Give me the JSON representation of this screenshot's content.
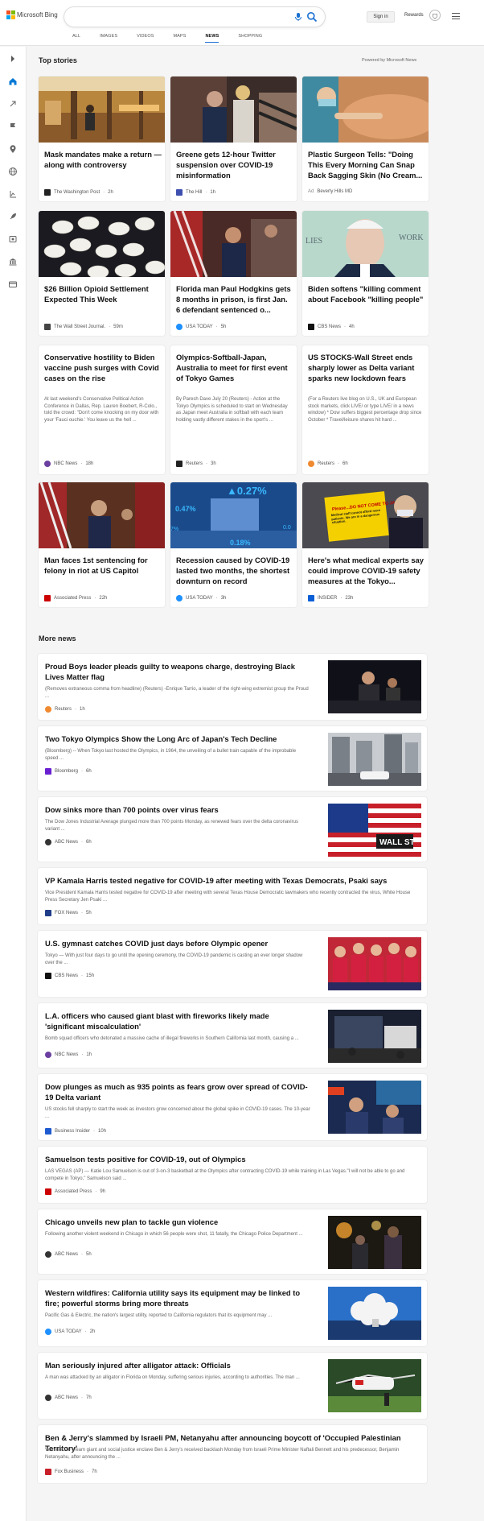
{
  "header": {
    "brand": "Microsoft Bing",
    "signin": "Sign in",
    "rewards": "Rewards",
    "tabs": [
      "ALL",
      "IMAGES",
      "VIDEOS",
      "MAPS",
      "NEWS",
      "SHOPPING"
    ],
    "active_tab": "NEWS"
  },
  "top_stories": {
    "title": "Top stories",
    "powered_by": "Powered by Microsoft News",
    "cards": [
      {
        "title": "Mask mandates make a return — along with controversy",
        "source": "The Washington Post",
        "time": "2h"
      },
      {
        "title": "Greene gets 12-hour Twitter suspension over COVID-19 misinformation",
        "source": "The Hill",
        "time": "1h"
      },
      {
        "title": "Plastic Surgeon Tells: \"Doing This Every Morning Can Snap Back Sagging Skin (No Cream...",
        "source": "Beverly Hills MD",
        "ad": "Ad"
      },
      {
        "title": "$26 Billion Opioid Settlement Expected This Week",
        "source": "The Wall Street Journal.",
        "time": "59m"
      },
      {
        "title": "Florida man Paul Hodgkins gets 8 months in prison, is first Jan. 6 defendant sentenced o...",
        "source": "USA TODAY",
        "time": "5h"
      },
      {
        "title": "Biden softens \"killing comment about Facebook \"killing people\"",
        "source": "CBS News",
        "time": "4h"
      },
      {
        "title": "Conservative hostility to Biden vaccine push surges with Covid cases on the rise",
        "snippet": "At last weekend's Conservative Political Action Conference in Dallas, Rep. Lauren Boebert, R-Colo., told the crowd: \"Don't come knocking on my door with your 'Fauci ouchie.' You leave us the hell ...",
        "source": "NBC News",
        "time": "18h"
      },
      {
        "title": "Olympics-Softball-Japan, Australia to meet for first event of Tokyo Games",
        "snippet": "By Paresh Dave July 20 (Reuters) - Action at the Tokyo Olympics is scheduled to start on Wednesday as Japan meet Australia in softball with each team holding vastly different stakes in the sport's ...",
        "source": "Reuters",
        "time": "3h"
      },
      {
        "title": "US STOCKS-Wall Street ends sharply lower as Delta variant sparks new lockdown fears",
        "snippet": "(For a Reuters live blog on U.S., UK and European stock markets, click LIVE/ or type LIVE/ in a news window) * Dow suffers biggest percentage drop since October * Travel/leisure shares hit hard ...",
        "source": "Reuters",
        "time": "6h"
      },
      {
        "title": "Man faces 1st sentencing for felony in riot at US Capitol",
        "source": "Associated Press",
        "time": "22h"
      },
      {
        "title": "Recession caused by COVID-19 lasted two months, the shortest downturn on record",
        "source": "USA TODAY",
        "time": "3h"
      },
      {
        "title": "Here's what medical experts say could improve COVID-19 safety measures at the Tokyo...",
        "source": "INSIDER",
        "time": "23h"
      }
    ],
    "thumb_texts": {
      "stock_big": "▲0.27%",
      "stock_a": "0.47%",
      "stock_b": "7%",
      "stock_c": "0.18%",
      "stock_d": "0.0",
      "sign_top": "Please...DO NOT COME TO JAPAN",
      "sign_body": "Medical staff cannot afford more patients. We are in a dangerous situation.",
      "lies": "LIES",
      "work": "WORK",
      "wall_st": "WALL ST"
    }
  },
  "more_news": {
    "title": "More news",
    "items": [
      {
        "title": "Proud Boys leader pleads guilty to weapons charge, destroying Black Lives Matter flag",
        "snippet": "(Removes extraneous comma from headline) (Reuters) -Enrique Tarrio, a leader of the right-wing extremist group the Proud ...",
        "source": "Reuters",
        "time": "1h"
      },
      {
        "title": "Two Tokyo Olympics Show the Long Arc of Japan's Tech Decline",
        "snippet": "(Bloomberg) -- When Tokyo last hosted the Olympics, in 1964, the unveiling of a bullet train capable of the improbable speed ...",
        "source": "Bloomberg",
        "time": "6h"
      },
      {
        "title": "Dow sinks more than 700 points over virus fears",
        "snippet": "The Dow Jones Industrial Average plunged more than 700 points Monday, as renewed fears over the delta coronavirus variant ...",
        "source": "ABC News",
        "time": "6h"
      },
      {
        "title": "VP Kamala Harris tested negative for COVID-19 after meeting with Texas Democrats, Psaki says",
        "snippet": "Vice President Kamala Harris tested negative for COVID-19 after meeting with several Texas House Democratic lawmakers who recently contracted the virus, White House Press Secretary Jen Psaki ...",
        "source": "FOX News",
        "time": "5h"
      },
      {
        "title": "U.S. gymnast catches COVID just days before Olympic opener",
        "snippet": "Tokyo — With just four days to go until the opening ceremony, the COVID-19 pandemic is casting an ever longer shadow over the ...",
        "source": "CBS News",
        "time": "15h"
      },
      {
        "title": "L.A. officers who caused giant blast with fireworks likely made 'significant miscalculation'",
        "snippet": "Bomb squad officers who detonated a massive cache of illegal fireworks in Southern California last month, causing a ...",
        "source": "NBC News",
        "time": "1h"
      },
      {
        "title": "Dow plunges as much as 935 points as fears grow over spread of COVID-19 Delta variant",
        "snippet": "US stocks fell sharply to start the week as investors grow concerned about the global spike in COVID-19 cases. The 10-year ...",
        "source": "Business Insider",
        "time": "10h"
      },
      {
        "title": "Samuelson tests positive for COVID-19, out of Olympics",
        "snippet": "LAS VEGAS (AP) — Katie Lou Samuelson is out of 3-on-3 basketball at the Olympics after contracting COVID-19 while training in Las Vegas.\"I will not be able to go and compete in Tokyo,\" Samuelson said ...",
        "source": "Associated Press",
        "time": "9h"
      },
      {
        "title": "Chicago unveils new plan to tackle gun violence",
        "snippet": "Following another violent weekend in Chicago in which 56 people were shot, 11 fatally, the Chicago Police Department ...",
        "source": "ABC News",
        "time": "5h"
      },
      {
        "title": "Western wildfires: California utility says its equipment may be linked to fire; powerful storms bring more threats",
        "snippet": "Pacific Gas & Electric, the nation's largest utility, reported to California regulators that its equipment may ...",
        "source": "USA TODAY",
        "time": "2h"
      },
      {
        "title": "Man seriously injured after alligator attack: Officials",
        "snippet": "A man was attacked by an alligator in Florida on Monday, suffering serious injuries, according to authorities. The man ...",
        "source": "ABC News",
        "time": "7h"
      },
      {
        "title": "Ben & Jerry's slammed by Israeli PM, Netanyahu after announcing boycott of 'Occupied Palestinian Territory'",
        "snippet": "Vermont ice cream giant and social justice enclave Ben & Jerry's received backlash Monday from Israeli Prime Minister Naftali Bennett and his predecessor, Benjamin Netanyahu, after announcing the ...",
        "source": "Fox Business",
        "time": "7h"
      }
    ]
  },
  "icons": [
    "expand-icon",
    "home-icon",
    "flame-icon",
    "flag-icon",
    "location-icon",
    "globe-icon",
    "science-icon",
    "rocket-icon",
    "entertainment-icon",
    "bank-icon",
    "card-icon",
    "search-icon",
    "mic-icon",
    "rewards-icon",
    "menu-icon"
  ],
  "colors": {
    "accent": "#1a6fd1",
    "sidebar_active": "#0078d4"
  }
}
